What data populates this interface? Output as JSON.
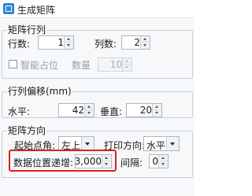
{
  "window": {
    "title": "生成矩阵",
    "icon": "app-icon"
  },
  "matrix_rows_cols": {
    "group_title": "矩阵行列",
    "rows_label": "行数:",
    "rows_value": "1",
    "cols_label": "列数:",
    "cols_value": "2",
    "smart_fill_label": "智能占位",
    "smart_fill_checked": false,
    "count_label": "数量",
    "count_value": "10"
  },
  "row_col_offset": {
    "group_title": "行列偏移(mm)",
    "horizontal_label": "水平:",
    "horizontal_value": "42",
    "vertical_label": "垂直:",
    "vertical_value": "20"
  },
  "matrix_direction": {
    "group_title": "矩阵方向",
    "start_corner_label": "起始点角:",
    "start_corner_value": "左上",
    "print_direction_label": "打印方向:",
    "print_direction_value": "水平",
    "data_step_label": "数据位置递增:",
    "data_step_value": "3,000",
    "interval_label": "间隔:",
    "interval_value": "0"
  },
  "colors": {
    "highlight": "#e0201c",
    "group_border": "#c7d0da"
  }
}
